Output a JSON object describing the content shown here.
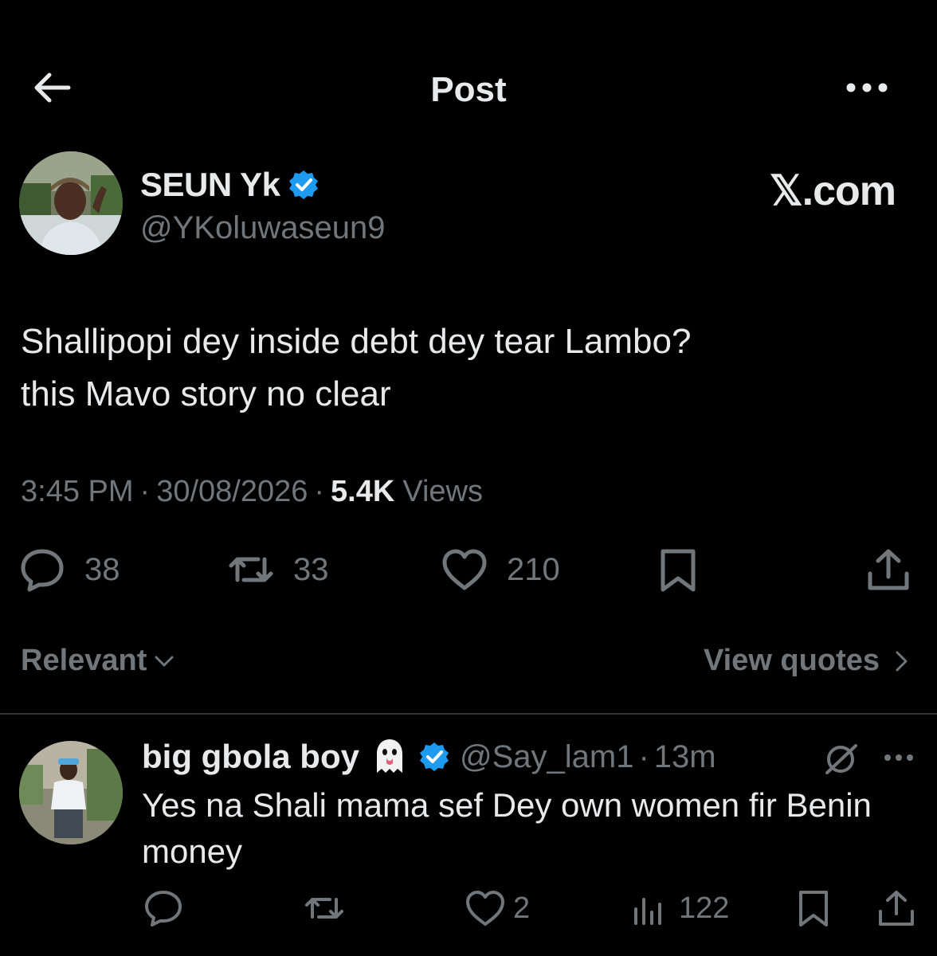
{
  "header": {
    "title": "Post"
  },
  "post": {
    "display_name": "SEUN Yk",
    "handle": "@YKoluwaseun9",
    "watermark": "𝕏.com",
    "text": "Shallipopi dey inside debt dey tear Lambo?\nthis Mavo story no clear",
    "time": "3:45 PM",
    "date": "30/08/2026",
    "views_count": "5.4K",
    "views_label": "Views",
    "replies": "38",
    "reposts": "33",
    "likes": "210"
  },
  "sort": {
    "relevant_label": "Relevant",
    "view_quotes_label": "View quotes"
  },
  "reply": {
    "display_name": "big gbola boy",
    "handle": "@Say_lam1",
    "time": "13m",
    "text": "Yes na Shali mama sef Dey own women fir Benin money",
    "likes": "2",
    "views": "122"
  },
  "icons": {
    "back": "arrow-left-icon",
    "more": "more-horizontal-icon",
    "verified": "verified-badge-icon",
    "reply": "speech-bubble-icon",
    "repost": "repost-icon",
    "like": "heart-icon",
    "bookmark": "bookmark-icon",
    "share": "share-icon",
    "views": "bar-chart-icon",
    "grok": "grok-icon",
    "ghost": "ghost-emoji-icon"
  },
  "colors": {
    "background": "#000000",
    "text": "#e7e9ea",
    "muted": "#71767b",
    "verified": "#1d9bf0",
    "divider": "#2f3336"
  }
}
